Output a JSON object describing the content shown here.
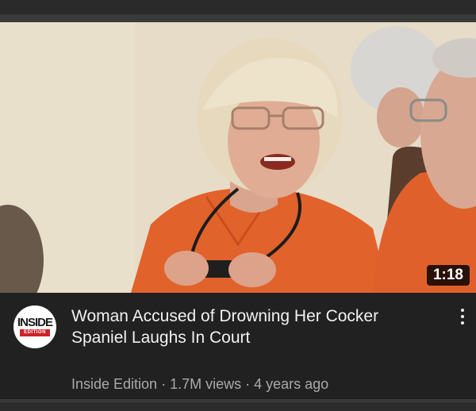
{
  "video": {
    "duration": "1:18",
    "title": "Woman Accused of Drowning Her Cocker Spaniel Laughs In Court",
    "channel": "Inside Edition",
    "views": "1.7M views",
    "age": "4 years ago",
    "separator": " · "
  },
  "channel_logo": {
    "top_text": "INSIDE",
    "sub_text": "EDITION",
    "accent_color": "#d0202a"
  },
  "icons": {
    "more_menu": "vertical-ellipsis-icon"
  },
  "colors": {
    "background": "#212121",
    "title_text": "#f1f1f1",
    "secondary_text": "#aaaaaa",
    "duration_badge": "#000000"
  }
}
